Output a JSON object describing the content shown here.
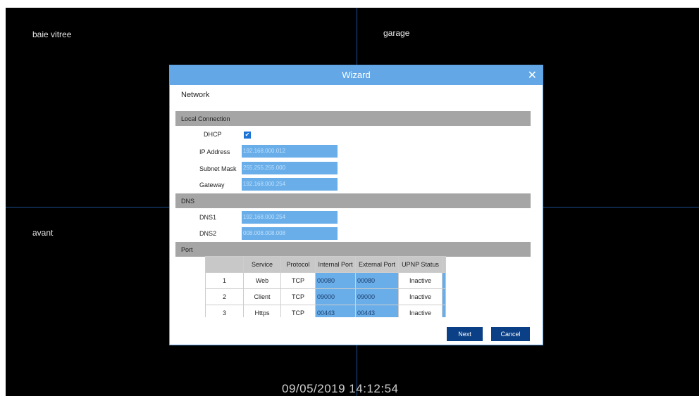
{
  "cameras": [
    "baie vitree",
    "garage",
    "avant"
  ],
  "clock": "09/05/2019 14:12:54",
  "wizard": {
    "title": "Wizard",
    "close_icon": "close-icon",
    "subtitle": "Network",
    "local": {
      "header": "Local Connection",
      "dhcp_label": "DHCP",
      "dhcp_checked": true,
      "ip_label": "IP Address",
      "ip": "192.168.000.012",
      "mask_label": "Subnet Mask",
      "mask": "255.255.255.000",
      "gw_label": "Gateway",
      "gw": "192.168.000.254"
    },
    "dns": {
      "header": "DNS",
      "dns1_label": "DNS1",
      "dns1": "192.168.000.254",
      "dns2_label": "DNS2",
      "dns2": "008.008.008.008"
    },
    "port": {
      "header": "Port",
      "columns": [
        "",
        "Service",
        "Protocol",
        "Internal Port",
        "External Port",
        "UPNP Status"
      ],
      "rows": [
        {
          "no": "1",
          "service": "Web",
          "protocol": "TCP",
          "internal": "00080",
          "external": "00080",
          "status": "Inactive"
        },
        {
          "no": "2",
          "service": "Client",
          "protocol": "TCP",
          "internal": "09000",
          "external": "09000",
          "status": "Inactive"
        },
        {
          "no": "3",
          "service": "Https",
          "protocol": "TCP",
          "internal": "00443",
          "external": "00443",
          "status": "Inactive"
        }
      ]
    },
    "next_label": "Next",
    "cancel_label": "Cancel"
  }
}
